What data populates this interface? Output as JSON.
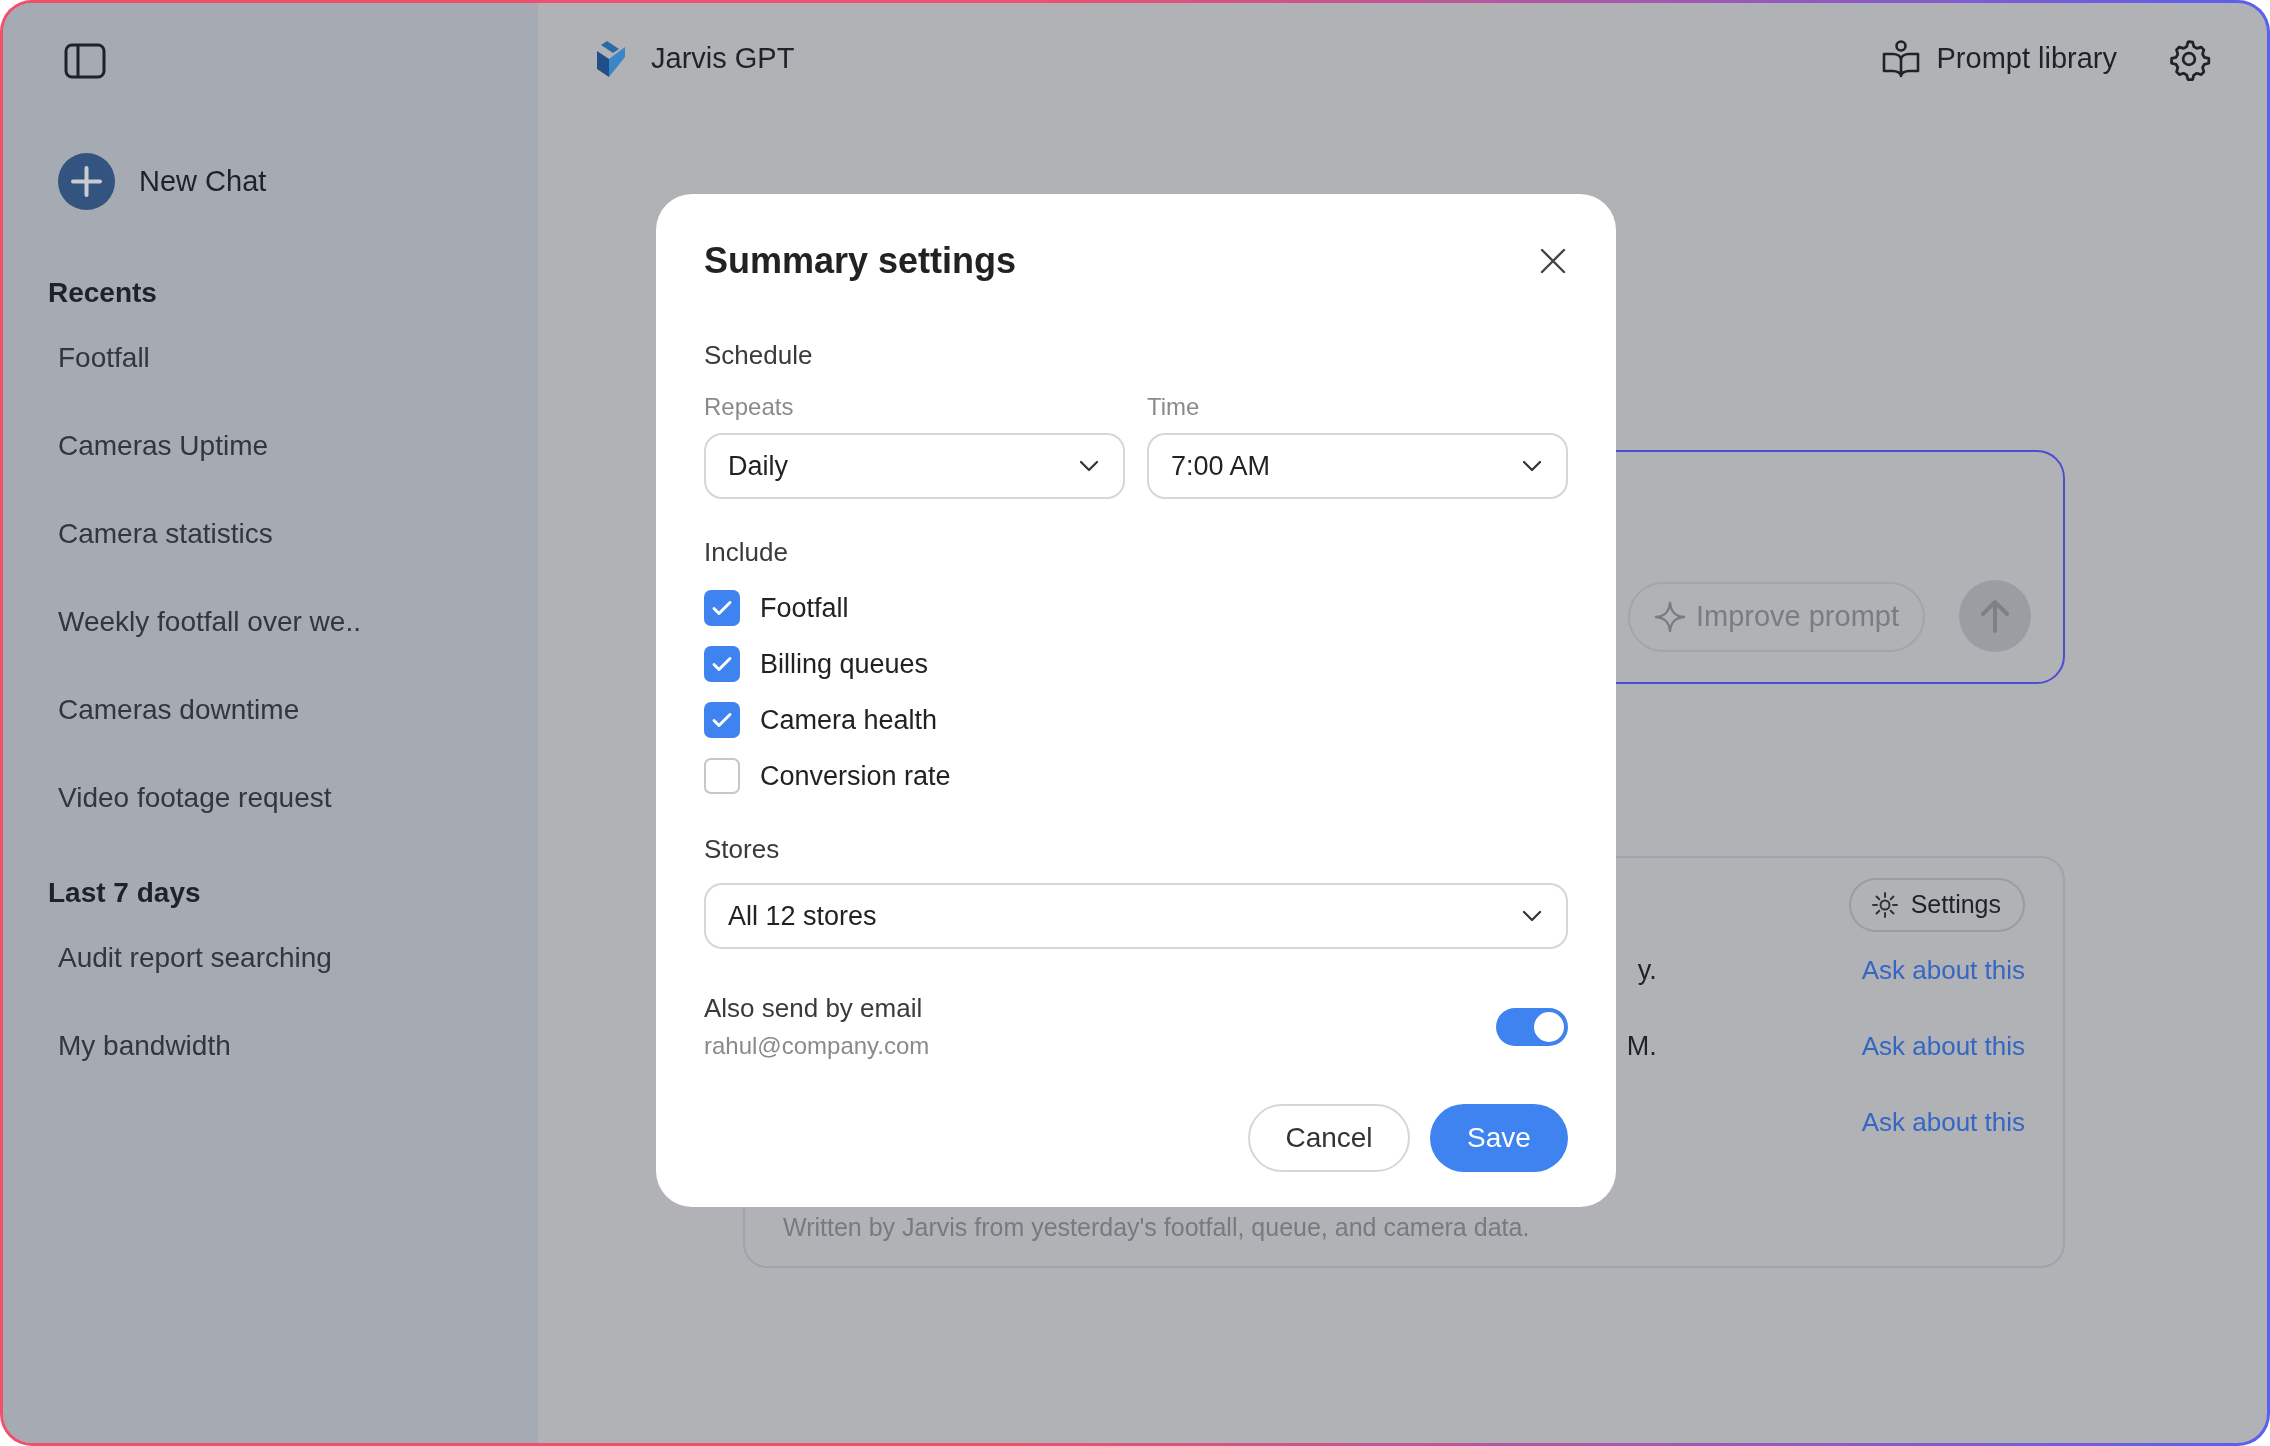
{
  "header": {
    "title": "Jarvis GPT",
    "prompt_library": "Prompt library"
  },
  "sidebar": {
    "new_chat": "New Chat",
    "sections": [
      {
        "title": "Recents",
        "items": [
          "Footfall",
          "Cameras Uptime",
          "Camera statistics",
          "Weekly footfall over we..",
          "Cameras downtime",
          "Video footage request"
        ]
      },
      {
        "title": "Last 7 days",
        "items": [
          "Audit report searching",
          "My bandwidth"
        ]
      }
    ]
  },
  "composer": {
    "improve_button": "Improve prompt"
  },
  "summary_card": {
    "settings_button": "Settings",
    "rows": [
      {
        "text": "y.",
        "action": "Ask about this"
      },
      {
        "text": "M.",
        "action": "Ask about this"
      },
      {
        "action": "Ask about this"
      }
    ],
    "footer": "Written by Jarvis from yesterday's footfall, queue, and camera data."
  },
  "dialog": {
    "title": "Summary settings",
    "schedule": {
      "label": "Schedule",
      "fields": [
        {
          "label": "Repeats",
          "value": "Daily"
        },
        {
          "label": "Time",
          "value": "7:00 AM"
        }
      ]
    },
    "include": {
      "label": "Include",
      "options": [
        {
          "label": "Footfall",
          "checked": true
        },
        {
          "label": "Billing queues",
          "checked": true
        },
        {
          "label": "Camera health",
          "checked": true
        },
        {
          "label": "Conversion rate",
          "checked": false
        }
      ]
    },
    "stores": {
      "label": "Stores",
      "value": "All 12 stores"
    },
    "email": {
      "label": "Also send by email",
      "address": "rahul@company.com",
      "on": true
    },
    "buttons": [
      {
        "label": "Cancel",
        "kind": "secondary"
      },
      {
        "label": "Save",
        "kind": "primary"
      }
    ]
  }
}
